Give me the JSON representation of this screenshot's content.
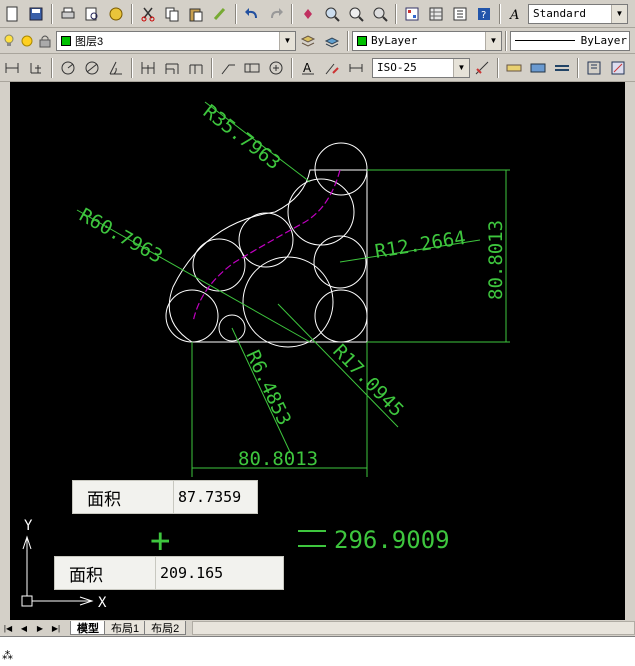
{
  "toolbar1": {
    "text_style_value": "Standard"
  },
  "toolbar2": {
    "layer_name": "图层3",
    "color_value": "ByLayer",
    "linetype_value": "ByLayer"
  },
  "toolbar3": {
    "dim_style_value": "ISO-25"
  },
  "drawing": {
    "radius_dims": [
      "R35.7963",
      "R60.7963",
      "R12.2664",
      "R6.4853",
      "R17.0945"
    ],
    "linear_dims": [
      "80.8013",
      "80.8013"
    ],
    "area_box_top": {
      "label": "面积",
      "value": "87.7359"
    },
    "area_box_bottom": {
      "label": "面积",
      "value": "209.165"
    },
    "plus_sign": "+",
    "equals_result": "296.9009",
    "ucs_y": "Y",
    "ucs_x": "X"
  },
  "tabs": {
    "items": [
      "模型",
      "布局1",
      "布局2"
    ]
  },
  "colors": {
    "dimension": "#3ec63e",
    "geometry": "#ffffff",
    "spline": "#c000c0",
    "background": "#000000"
  }
}
